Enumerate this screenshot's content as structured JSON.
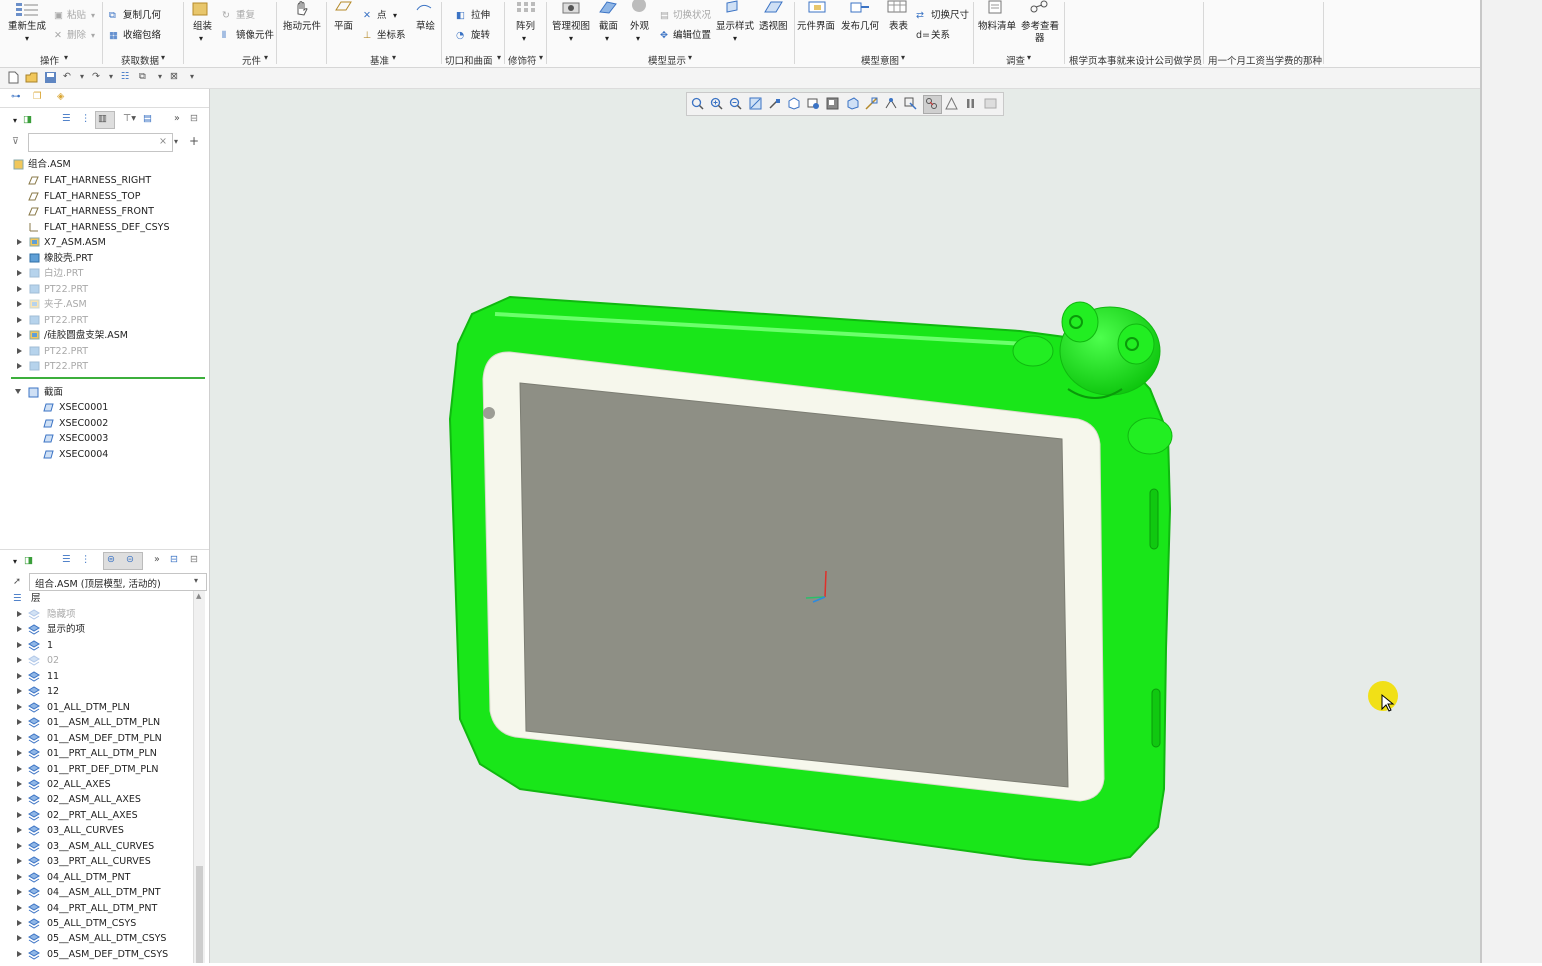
{
  "ribbon": {
    "groups": [
      "操作",
      "获取数据",
      "元件",
      "基准",
      "切口和曲面",
      "修饰符",
      "模型显示",
      "模型意图",
      "调查",
      "根学页本事就来设计公司做学员",
      "用一个月工资当学费的那种"
    ],
    "buttons": {
      "regenerate": "重新生成",
      "paste": "粘贴",
      "delete": "删除",
      "copy_geometry": "复制几何",
      "shrinkwrap": "收缩包络",
      "assemble": "组装",
      "repeat": "重复",
      "mirror_component": "镜像元件",
      "drag_components": "拖动元件",
      "plane": "平面",
      "point": "点",
      "csys": "坐标系",
      "sketch": "草绘",
      "extrude": "拉伸",
      "revolve": "旋转",
      "pattern": "阵列",
      "manage_views": "管理视图",
      "section": "截面",
      "appearance": "外观",
      "toggle_status": "切换状况",
      "edit_position": "编辑位置",
      "display_style": "显示样式",
      "perspective_view": "透视图",
      "component_interface": "元件界面",
      "publish_geometry": "发布几何",
      "table": "表表",
      "switch_dimensions": "切换尺寸",
      "relations": "关系",
      "bom": "物料清单",
      "reference_viewer_1": "参考查看",
      "reference_viewer_2": "器"
    }
  },
  "model_tree": {
    "root": "组合.ASM",
    "items": [
      {
        "label": "FLAT_HARNESS_RIGHT",
        "icon": "datum-plane-icon",
        "gray": false,
        "expand": false
      },
      {
        "label": "FLAT_HARNESS_TOP",
        "icon": "datum-plane-icon",
        "gray": false,
        "expand": false
      },
      {
        "label": "FLAT_HARNESS_FRONT",
        "icon": "datum-plane-icon",
        "gray": false,
        "expand": false
      },
      {
        "label": "FLAT_HARNESS_DEF_CSYS",
        "icon": "csys-icon",
        "gray": false,
        "expand": false
      },
      {
        "label": "X7_ASM.ASM",
        "icon": "assembly-icon",
        "gray": false,
        "expand": true
      },
      {
        "label": "橡胶壳.PRT",
        "icon": "part-icon",
        "gray": false,
        "expand": true
      },
      {
        "label": "白边.PRT",
        "icon": "part-icon",
        "gray": true,
        "expand": true
      },
      {
        "label": "PT22.PRT",
        "icon": "part-icon",
        "gray": true,
        "expand": true
      },
      {
        "label": "夹子.ASM",
        "icon": "assembly-icon",
        "gray": true,
        "expand": true
      },
      {
        "label": "PT22.PRT",
        "icon": "part-icon",
        "gray": true,
        "expand": true
      },
      {
        "label": "/硅胶圆盘支架.ASM",
        "icon": "assembly-icon",
        "gray": false,
        "expand": true
      },
      {
        "label": "PT22.PRT",
        "icon": "part-icon",
        "gray": true,
        "expand": true
      },
      {
        "label": "PT22.PRT",
        "icon": "part-icon",
        "gray": true,
        "expand": true
      }
    ],
    "sections_label": "截面",
    "sections": [
      "XSEC0001",
      "XSEC0002",
      "XSEC0003",
      "XSEC0004"
    ]
  },
  "layer_tree": {
    "dropdown_value": "组合.ASM (顶层模型, 活动的)",
    "root": "层",
    "items": [
      {
        "label": "隐藏项",
        "gray": true
      },
      {
        "label": "显示的项",
        "gray": false
      },
      {
        "label": "1",
        "gray": false
      },
      {
        "label": "02",
        "gray": true
      },
      {
        "label": "11",
        "gray": false
      },
      {
        "label": "12",
        "gray": false
      },
      {
        "label": "01_ALL_DTM_PLN",
        "gray": false
      },
      {
        "label": "01__ASM_ALL_DTM_PLN",
        "gray": false
      },
      {
        "label": "01__ASM_DEF_DTM_PLN",
        "gray": false
      },
      {
        "label": "01__PRT_ALL_DTM_PLN",
        "gray": false
      },
      {
        "label": "01__PRT_DEF_DTM_PLN",
        "gray": false
      },
      {
        "label": "02_ALL_AXES",
        "gray": false
      },
      {
        "label": "02__ASM_ALL_AXES",
        "gray": false
      },
      {
        "label": "02__PRT_ALL_AXES",
        "gray": false
      },
      {
        "label": "03_ALL_CURVES",
        "gray": false
      },
      {
        "label": "03__ASM_ALL_CURVES",
        "gray": false
      },
      {
        "label": "03__PRT_ALL_CURVES",
        "gray": false
      },
      {
        "label": "04_ALL_DTM_PNT",
        "gray": false
      },
      {
        "label": "04__ASM_ALL_DTM_PNT",
        "gray": false
      },
      {
        "label": "04__PRT_ALL_DTM_PNT",
        "gray": false
      },
      {
        "label": "05_ALL_DTM_CSYS",
        "gray": false
      },
      {
        "label": "05__ASM_ALL_DTM_CSYS",
        "gray": false
      },
      {
        "label": "05__ASM_DEF_DTM_CSYS",
        "gray": false
      }
    ]
  },
  "colors": {
    "viewport_bg": "#e6ebe8",
    "model_green": "#19e619",
    "bezel_white": "#f6f7ec",
    "screen_gray": "#8e8f85",
    "cursor_highlight": "#f2df00"
  }
}
